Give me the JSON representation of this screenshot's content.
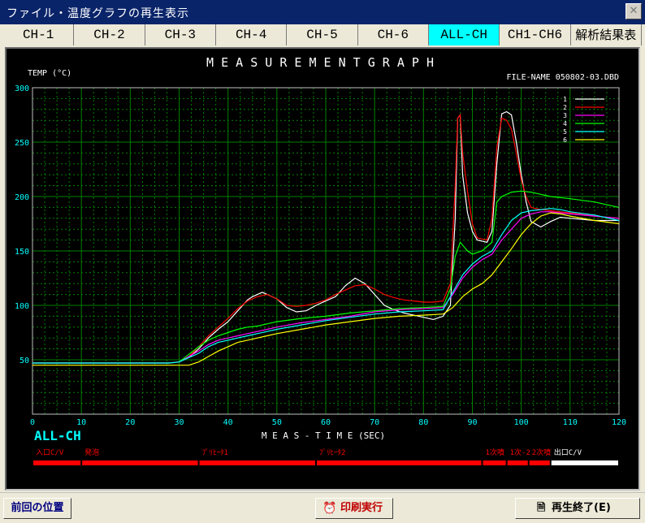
{
  "window": {
    "title": "ファイル・温度グラフの再生表示",
    "close_label": "✕"
  },
  "tabs": [
    {
      "label": "CH-1",
      "active": false
    },
    {
      "label": "CH-2",
      "active": false
    },
    {
      "label": "CH-3",
      "active": false
    },
    {
      "label": "CH-4",
      "active": false
    },
    {
      "label": "CH-5",
      "active": false
    },
    {
      "label": "CH-6",
      "active": false
    },
    {
      "label": "ALL-CH",
      "active": true
    },
    {
      "label": "CH1-CH6",
      "active": false
    },
    {
      "label": "解析結果表示",
      "active": false
    }
  ],
  "graph": {
    "title": "M E A S U R E M E N T   G R A P H",
    "ylabel": "TEMP (°C)",
    "file_label": "FILE-NAME  050802-03.DBD",
    "xlabel": "M E A S - T I M E   (SEC)",
    "channel_label": "ALL-CH"
  },
  "zones": [
    {
      "label": "入口C/V",
      "start": 0,
      "end": 10,
      "color": "#ff0000"
    },
    {
      "label": "発泡",
      "start": 10,
      "end": 34,
      "color": "#ff0000"
    },
    {
      "label": "ﾌﾟﾘﾋｰﾀ1",
      "start": 34,
      "end": 58,
      "color": "#ff0000"
    },
    {
      "label": "ﾌﾟﾘﾋｰﾀ2",
      "start": 58,
      "end": 92,
      "color": "#ff0000"
    },
    {
      "label": "1次噴",
      "start": 92,
      "end": 97,
      "color": "#ff0000"
    },
    {
      "label": "1次-2",
      "start": 97,
      "end": 101.5,
      "color": "#ff0000"
    },
    {
      "label": "2次噴",
      "start": 101.5,
      "end": 106,
      "color": "#ff0000"
    },
    {
      "label": "出口C/V",
      "start": 106,
      "end": 120,
      "color": "#ffffff"
    }
  ],
  "chart_data": {
    "type": "line",
    "xlim": [
      0,
      120
    ],
    "ylim": [
      0,
      300
    ],
    "x_ticks": [
      0,
      10,
      20,
      30,
      40,
      50,
      60,
      70,
      80,
      90,
      100,
      110,
      120
    ],
    "y_ticks": [
      50,
      100,
      150,
      200,
      250,
      300
    ],
    "grid": true,
    "legend_position": "top-right",
    "series": [
      {
        "name": "1",
        "color": "#ffffff",
        "points": [
          [
            0,
            47
          ],
          [
            10,
            47
          ],
          [
            20,
            47
          ],
          [
            28,
            47
          ],
          [
            30,
            48
          ],
          [
            32,
            52
          ],
          [
            34,
            60
          ],
          [
            36,
            70
          ],
          [
            38,
            78
          ],
          [
            40,
            85
          ],
          [
            42,
            95
          ],
          [
            44,
            105
          ],
          [
            45,
            108
          ],
          [
            47,
            112
          ],
          [
            48,
            110
          ],
          [
            50,
            106
          ],
          [
            52,
            98
          ],
          [
            54,
            94
          ],
          [
            56,
            95
          ],
          [
            58,
            100
          ],
          [
            60,
            104
          ],
          [
            62,
            108
          ],
          [
            64,
            118
          ],
          [
            66,
            125
          ],
          [
            68,
            120
          ],
          [
            70,
            110
          ],
          [
            72,
            100
          ],
          [
            74,
            96
          ],
          [
            76,
            93
          ],
          [
            78,
            91
          ],
          [
            80,
            89
          ],
          [
            82,
            87
          ],
          [
            84,
            90
          ],
          [
            85.5,
            100
          ],
          [
            86.5,
            180
          ],
          [
            87,
            272
          ],
          [
            87.5,
            275
          ],
          [
            88,
            220
          ],
          [
            89,
            185
          ],
          [
            90,
            168
          ],
          [
            91,
            160
          ],
          [
            93,
            158
          ],
          [
            94,
            168
          ],
          [
            95,
            230
          ],
          [
            96,
            276
          ],
          [
            97,
            278
          ],
          [
            98,
            275
          ],
          [
            99,
            250
          ],
          [
            100,
            220
          ],
          [
            101,
            195
          ],
          [
            102,
            177
          ],
          [
            104,
            172
          ],
          [
            106,
            177
          ],
          [
            108,
            181
          ],
          [
            110,
            180
          ],
          [
            115,
            178
          ],
          [
            120,
            178
          ]
        ]
      },
      {
        "name": "2",
        "color": "#ff0000",
        "points": [
          [
            0,
            47
          ],
          [
            10,
            47
          ],
          [
            20,
            47
          ],
          [
            28,
            47
          ],
          [
            30,
            48
          ],
          [
            32,
            53
          ],
          [
            34,
            62
          ],
          [
            36,
            72
          ],
          [
            38,
            80
          ],
          [
            40,
            88
          ],
          [
            42,
            97
          ],
          [
            44,
            104
          ],
          [
            46,
            108
          ],
          [
            48,
            110
          ],
          [
            50,
            106
          ],
          [
            52,
            100
          ],
          [
            54,
            99
          ],
          [
            56,
            100
          ],
          [
            58,
            102
          ],
          [
            60,
            105
          ],
          [
            62,
            110
          ],
          [
            64,
            114
          ],
          [
            66,
            118
          ],
          [
            68,
            119
          ],
          [
            70,
            115
          ],
          [
            72,
            110
          ],
          [
            74,
            107
          ],
          [
            76,
            105
          ],
          [
            78,
            104
          ],
          [
            80,
            103
          ],
          [
            82,
            103
          ],
          [
            84,
            104
          ],
          [
            85.5,
            120
          ],
          [
            86.5,
            210
          ],
          [
            87,
            272
          ],
          [
            87.5,
            275
          ],
          [
            88,
            240
          ],
          [
            89,
            205
          ],
          [
            90,
            175
          ],
          [
            91,
            162
          ],
          [
            93,
            160
          ],
          [
            94,
            180
          ],
          [
            95,
            245
          ],
          [
            96,
            272
          ],
          [
            97,
            270
          ],
          [
            98,
            262
          ],
          [
            99,
            240
          ],
          [
            100,
            215
          ],
          [
            101,
            200
          ],
          [
            102,
            190
          ],
          [
            104,
            188
          ],
          [
            106,
            187
          ],
          [
            108,
            186
          ],
          [
            110,
            185
          ],
          [
            115,
            182
          ],
          [
            120,
            180
          ]
        ]
      },
      {
        "name": "3",
        "color": "#ff00ff",
        "points": [
          [
            0,
            47
          ],
          [
            10,
            47
          ],
          [
            20,
            47
          ],
          [
            28,
            47
          ],
          [
            30,
            48
          ],
          [
            32,
            53
          ],
          [
            34,
            58
          ],
          [
            36,
            64
          ],
          [
            38,
            68
          ],
          [
            40,
            70
          ],
          [
            42,
            72
          ],
          [
            44,
            74
          ],
          [
            46,
            76
          ],
          [
            48,
            78
          ],
          [
            50,
            80
          ],
          [
            55,
            84
          ],
          [
            60,
            87
          ],
          [
            65,
            90
          ],
          [
            70,
            94
          ],
          [
            75,
            96
          ],
          [
            80,
            97
          ],
          [
            84,
            98
          ],
          [
            86,
            110
          ],
          [
            88,
            125
          ],
          [
            90,
            135
          ],
          [
            92,
            142
          ],
          [
            94,
            147
          ],
          [
            96,
            160
          ],
          [
            98,
            170
          ],
          [
            100,
            180
          ],
          [
            102,
            184
          ],
          [
            104,
            186
          ],
          [
            106,
            186
          ],
          [
            108,
            185
          ],
          [
            110,
            184
          ],
          [
            115,
            182
          ],
          [
            120,
            180
          ]
        ]
      },
      {
        "name": "4",
        "color": "#00ff00",
        "points": [
          [
            0,
            47
          ],
          [
            10,
            47
          ],
          [
            20,
            47
          ],
          [
            28,
            47
          ],
          [
            30,
            48
          ],
          [
            32,
            55
          ],
          [
            34,
            62
          ],
          [
            36,
            68
          ],
          [
            38,
            72
          ],
          [
            40,
            75
          ],
          [
            42,
            78
          ],
          [
            44,
            80
          ],
          [
            46,
            81
          ],
          [
            48,
            83
          ],
          [
            50,
            85
          ],
          [
            55,
            88
          ],
          [
            60,
            90
          ],
          [
            65,
            93
          ],
          [
            70,
            95
          ],
          [
            75,
            97
          ],
          [
            80,
            98
          ],
          [
            84,
            99
          ],
          [
            85.5,
            115
          ],
          [
            86.5,
            145
          ],
          [
            87.5,
            158
          ],
          [
            89,
            150
          ],
          [
            90,
            147
          ],
          [
            92,
            150
          ],
          [
            94,
            158
          ],
          [
            95,
            195
          ],
          [
            96,
            200
          ],
          [
            98,
            204
          ],
          [
            100,
            205
          ],
          [
            102,
            204
          ],
          [
            104,
            202
          ],
          [
            106,
            200
          ],
          [
            108,
            199
          ],
          [
            110,
            198
          ],
          [
            115,
            195
          ],
          [
            120,
            190
          ]
        ]
      },
      {
        "name": "5",
        "color": "#00ffff",
        "points": [
          [
            0,
            47
          ],
          [
            10,
            47
          ],
          [
            20,
            47
          ],
          [
            28,
            47
          ],
          [
            30,
            48
          ],
          [
            32,
            52
          ],
          [
            34,
            56
          ],
          [
            36,
            62
          ],
          [
            38,
            66
          ],
          [
            40,
            68
          ],
          [
            42,
            70
          ],
          [
            44,
            72
          ],
          [
            46,
            74
          ],
          [
            48,
            76
          ],
          [
            50,
            78
          ],
          [
            55,
            82
          ],
          [
            60,
            86
          ],
          [
            65,
            89
          ],
          [
            70,
            92
          ],
          [
            75,
            94
          ],
          [
            80,
            95
          ],
          [
            84,
            96
          ],
          [
            86,
            112
          ],
          [
            88,
            128
          ],
          [
            90,
            138
          ],
          [
            92,
            145
          ],
          [
            94,
            150
          ],
          [
            96,
            165
          ],
          [
            98,
            178
          ],
          [
            100,
            185
          ],
          [
            102,
            187
          ],
          [
            104,
            188
          ],
          [
            106,
            189
          ],
          [
            108,
            188
          ],
          [
            110,
            186
          ],
          [
            115,
            183
          ],
          [
            120,
            178
          ]
        ]
      },
      {
        "name": "6",
        "color": "#ffff00",
        "points": [
          [
            0,
            45
          ],
          [
            10,
            45
          ],
          [
            20,
            45
          ],
          [
            28,
            45
          ],
          [
            32,
            45
          ],
          [
            34,
            48
          ],
          [
            36,
            53
          ],
          [
            38,
            58
          ],
          [
            40,
            62
          ],
          [
            42,
            66
          ],
          [
            44,
            68
          ],
          [
            46,
            70
          ],
          [
            48,
            72
          ],
          [
            50,
            74
          ],
          [
            55,
            78
          ],
          [
            60,
            82
          ],
          [
            65,
            85
          ],
          [
            70,
            88
          ],
          [
            75,
            90
          ],
          [
            80,
            91
          ],
          [
            84,
            92
          ],
          [
            86,
            98
          ],
          [
            88,
            108
          ],
          [
            90,
            115
          ],
          [
            92,
            120
          ],
          [
            94,
            128
          ],
          [
            96,
            140
          ],
          [
            98,
            152
          ],
          [
            100,
            165
          ],
          [
            102,
            175
          ],
          [
            104,
            182
          ],
          [
            106,
            185
          ],
          [
            108,
            184
          ],
          [
            110,
            182
          ],
          [
            115,
            178
          ],
          [
            120,
            175
          ]
        ]
      }
    ]
  },
  "status": {
    "prev_position_label": "前回の位置",
    "print_label": "印刷実行",
    "exit_label": "再生終了(E)"
  }
}
